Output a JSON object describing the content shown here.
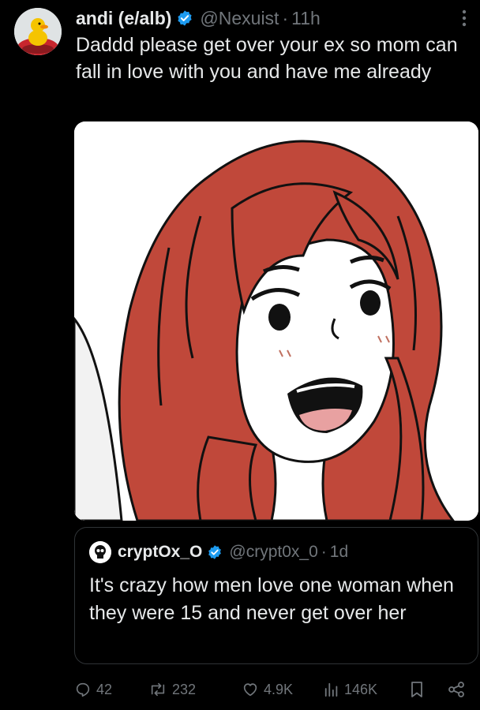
{
  "tweet": {
    "author_name": "andi (e/alb)",
    "handle": "@Nexuist",
    "separator": "·",
    "time": "11h",
    "text": "Daddd please get over your ex so mom can fall in love with you and have me already",
    "more_icon": "more-vertical-icon"
  },
  "quoted": {
    "author_name": "cryptOx_O",
    "handle": "@crypt0x_0",
    "separator": "·",
    "time": "1d",
    "text": "It's crazy how men love one woman when they were 15 and never get over her"
  },
  "actions": {
    "replies": "42",
    "retweets": "232",
    "likes": "4.9K",
    "views": "146K"
  },
  "colors": {
    "background": "#000000",
    "text": "#e7e9ea",
    "secondary_text": "#71767b",
    "verified": "#1d9bf0",
    "hair": "#c0483a"
  }
}
